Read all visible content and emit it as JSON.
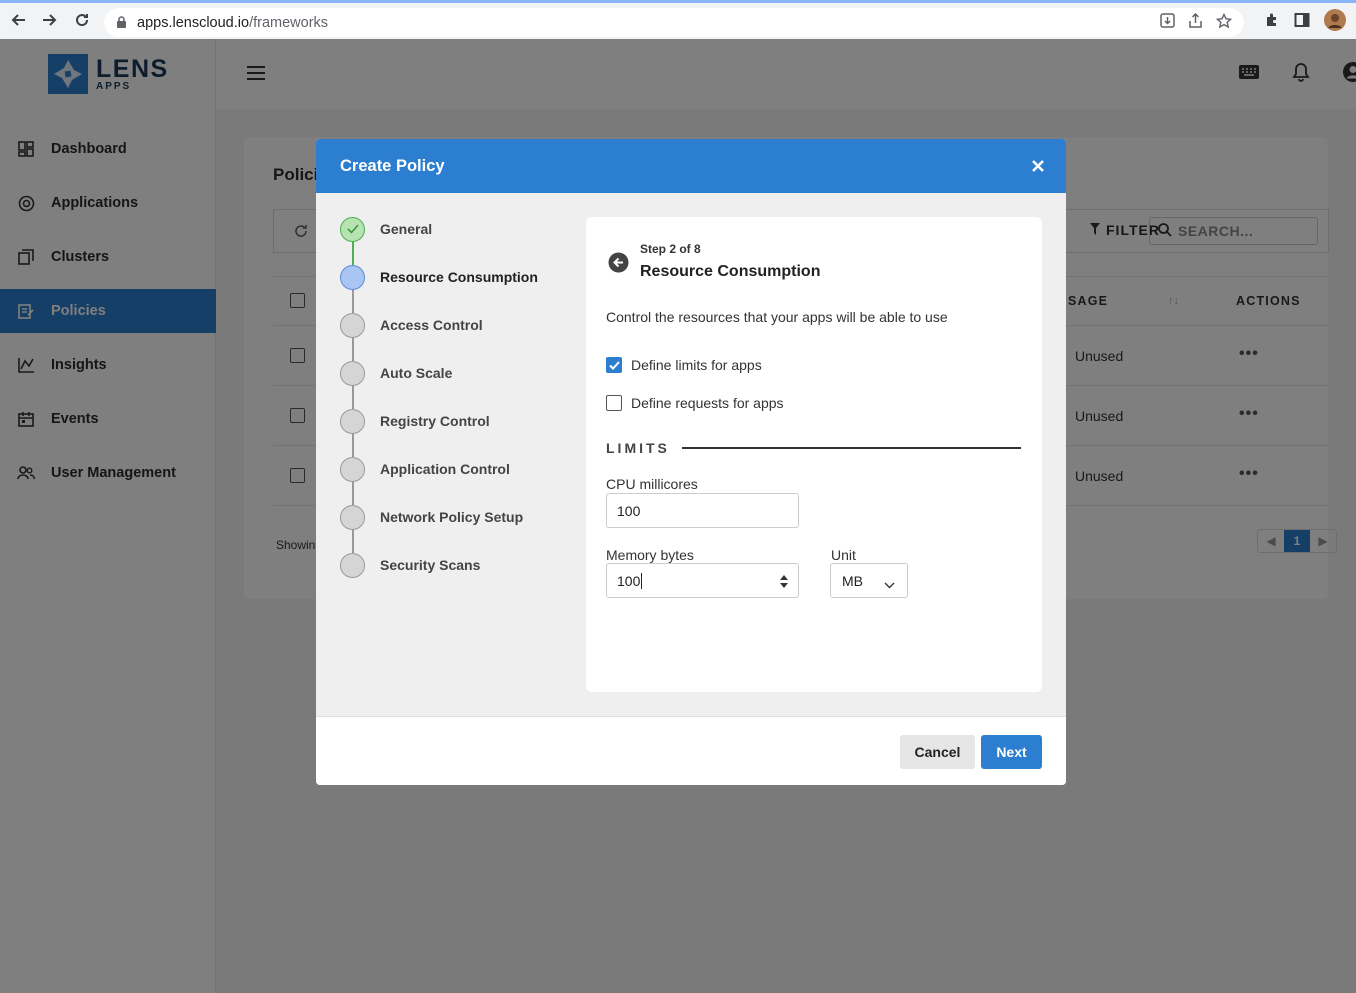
{
  "browser": {
    "url_domain": "apps.lenscloud.io",
    "url_path": "/frameworks"
  },
  "app": {
    "logo_main": "LENS",
    "logo_sub": "APPS",
    "sidebar": [
      {
        "label": "Dashboard",
        "icon": "dashboard-icon"
      },
      {
        "label": "Applications",
        "icon": "applications-icon"
      },
      {
        "label": "Clusters",
        "icon": "clusters-icon"
      },
      {
        "label": "Policies",
        "icon": "policies-icon",
        "active": true
      },
      {
        "label": "Insights",
        "icon": "insights-icon"
      },
      {
        "label": "Events",
        "icon": "events-icon"
      },
      {
        "label": "User Management",
        "icon": "users-icon"
      }
    ],
    "page_title": "Polici",
    "filter_label": "FILTER",
    "search_placeholder": "SEARCH...",
    "columns": {
      "usage": "SAGE",
      "actions": "ACTIONS"
    },
    "rows": [
      {
        "usage": "Unused",
        "actions": "•••"
      },
      {
        "usage": "Unused",
        "actions": "•••"
      },
      {
        "usage": "Unused",
        "actions": "•••"
      }
    ],
    "showing_text": "Showin",
    "page_number": "1"
  },
  "modal": {
    "title": "Create Policy",
    "steps": [
      {
        "label": "General",
        "state": "done"
      },
      {
        "label": "Resource Consumption",
        "state": "current"
      },
      {
        "label": "Access Control",
        "state": "pending"
      },
      {
        "label": "Auto Scale",
        "state": "pending"
      },
      {
        "label": "Registry Control",
        "state": "pending"
      },
      {
        "label": "Application Control",
        "state": "pending"
      },
      {
        "label": "Network Policy Setup",
        "state": "pending"
      },
      {
        "label": "Security Scans",
        "state": "pending"
      }
    ],
    "panel": {
      "step_count": "Step 2 of 8",
      "title": "Resource Consumption",
      "description": "Control the resources that your apps will be able to use",
      "check_limits_label": "Define limits for apps",
      "check_limits_checked": true,
      "check_requests_label": "Define requests for apps",
      "check_requests_checked": false,
      "section_label": "LIMITS",
      "cpu_label": "CPU millicores",
      "cpu_value": "100",
      "memory_label": "Memory bytes",
      "memory_value": "100",
      "unit_label": "Unit",
      "unit_value": "MB"
    },
    "cancel_label": "Cancel",
    "next_label": "Next"
  },
  "colors": {
    "brand": "#2c7fd0",
    "step_done": "#4caf50",
    "step_current": "#a9c5f4"
  }
}
